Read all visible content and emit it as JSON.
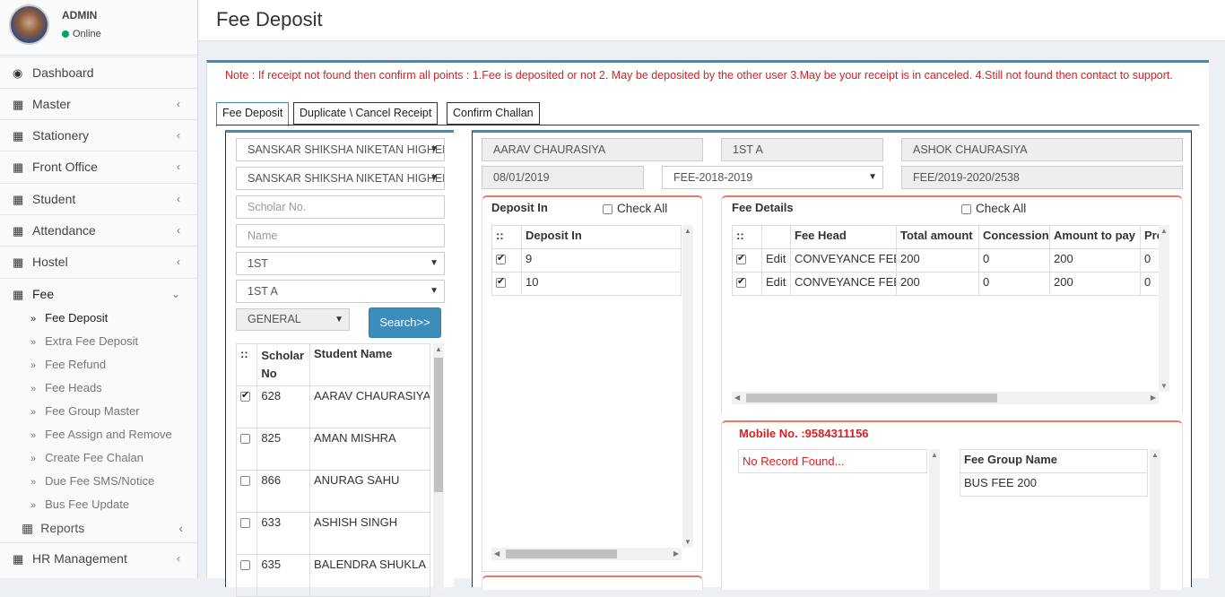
{
  "user": {
    "name": "ADMIN",
    "status": "Online"
  },
  "sidebar": {
    "items": [
      {
        "label": "Dashboard",
        "icon": "dashboard-icon"
      },
      {
        "label": "Master",
        "icon": "grid-icon"
      },
      {
        "label": "Stationery",
        "icon": "grid-icon"
      },
      {
        "label": "Front Office",
        "icon": "grid-icon"
      },
      {
        "label": "Student",
        "icon": "grid-icon"
      },
      {
        "label": "Attendance",
        "icon": "grid-icon"
      },
      {
        "label": "Hostel",
        "icon": "grid-icon"
      },
      {
        "label": "Fee",
        "icon": "grid-icon"
      }
    ],
    "fee_sub": [
      "Fee Deposit",
      "Extra Fee Deposit",
      "Fee Refund",
      "Fee Heads",
      "Fee Group Master",
      "Fee Assign and Remove",
      "Create Fee Chalan",
      "Due Fee SMS/Notice",
      "Bus Fee Update"
    ],
    "reports": "Reports",
    "hr": "HR Management"
  },
  "page": {
    "title": "Fee Deposit"
  },
  "note": "Note : If receipt not found then confirm all points : 1.Fee is deposited or not 2. May be deposited by the other user 3.May be your receipt is in canceled. 4.Still not found then contact to support.",
  "tabs": [
    "Fee Deposit",
    "Duplicate \\ Cancel Receipt",
    "Confirm Challan"
  ],
  "search": {
    "school1": "SANSKAR SHIKSHA NIKETAN HIGHER SECONDARY",
    "school2": "SANSKAR SHIKSHA NIKETAN HIGHER SECONDARY",
    "scholar_placeholder": "Scholar No.",
    "name_placeholder": "Name",
    "class": "1ST",
    "section": "1ST A",
    "category": "GENERAL",
    "button": "Search>>"
  },
  "students": {
    "headers": [
      "::",
      "Scholar No",
      "Student Name"
    ],
    "rows": [
      {
        "checked": true,
        "no": "628",
        "name": "AARAV CHAURASIYA"
      },
      {
        "checked": false,
        "no": "825",
        "name": "AMAN MISHRA"
      },
      {
        "checked": false,
        "no": "866",
        "name": "ANURAG SAHU"
      },
      {
        "checked": false,
        "no": "633",
        "name": "ASHISH SINGH"
      },
      {
        "checked": false,
        "no": "635",
        "name": "BALENDRA SHUKLA"
      }
    ]
  },
  "info": {
    "student": "AARAV  CHAURASIYA",
    "class": "1ST A",
    "father": "ASHOK CHAURASIYA",
    "date": "08/01/2019",
    "session": "FEE-2018-2019",
    "receipt": "FEE/2019-2020/2538"
  },
  "deposit": {
    "title": "Deposit In",
    "check_all": "Check All",
    "headers": [
      "::",
      "Deposit In"
    ],
    "rows": [
      {
        "checked": true,
        "value": "9"
      },
      {
        "checked": true,
        "value": "10"
      }
    ]
  },
  "fee_details": {
    "title": "Fee Details",
    "check_all": "Check All",
    "headers": [
      "::",
      "",
      "Fee Head",
      "Total amount",
      "Concession",
      "Amount to pay",
      "Pre"
    ],
    "rows": [
      {
        "checked": true,
        "edit": "Edit",
        "head": "CONVEYANCE FEE",
        "total": "200",
        "concession": "0",
        "pay": "200",
        "pre": "0"
      },
      {
        "checked": true,
        "edit": "Edit",
        "head": "CONVEYANCE FEE",
        "total": "200",
        "concession": "0",
        "pay": "200",
        "pre": "0"
      }
    ]
  },
  "mobile": {
    "label": "Mobile No. :9584311156",
    "no_record": "No Record Found..."
  },
  "fee_group": {
    "header": "Fee Group Name",
    "value": "BUS FEE 200"
  }
}
